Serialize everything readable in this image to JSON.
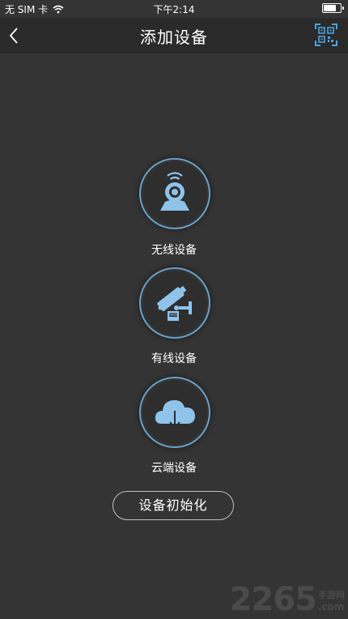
{
  "status_bar": {
    "carrier": "无 SIM 卡",
    "time": "下午2:14",
    "wifi_icon": "wifi-icon",
    "battery_icon": "battery-icon"
  },
  "nav": {
    "title": "添加设备",
    "back_icon": "chevron-left-icon",
    "scan_icon": "qr-code-scan-icon"
  },
  "devices": [
    {
      "label": "无线设备",
      "icon": "wireless-camera-icon"
    },
    {
      "label": "有线设备",
      "icon": "wired-camera-icon"
    },
    {
      "label": "云端设备",
      "icon": "cloud-download-icon"
    }
  ],
  "init_button": {
    "label": "设备初始化"
  },
  "watermark": {
    "number": "2265",
    "site_cn": "手游网",
    "site_en": ".com"
  },
  "colors": {
    "background": "#343434",
    "navbar": "#2a2a2a",
    "icon_blue": "#6aa2c9",
    "ring_border": "#6aa2c9"
  }
}
